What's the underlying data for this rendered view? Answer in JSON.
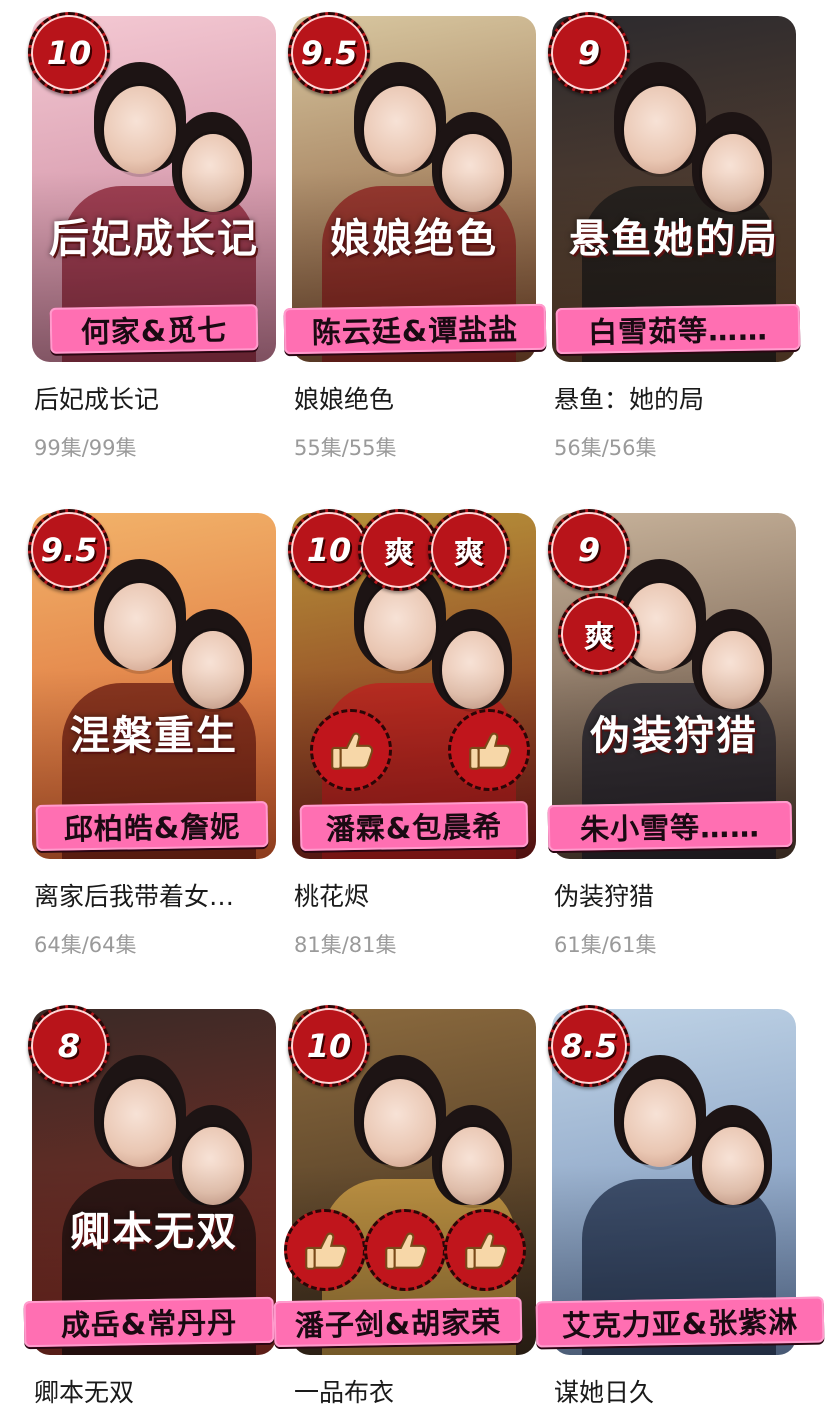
{
  "dramas": [
    {
      "title": "后妃成长记",
      "episodes": "99集/99集",
      "cast": "何家&觅七",
      "poster_title": "后妃成长记",
      "badges": [
        "10"
      ],
      "thumbs": 0,
      "bg": [
        "#f4c9d3",
        "#c27a93"
      ],
      "accent": "#8a1e32"
    },
    {
      "title": "娘娘绝色",
      "episodes": "55集/55集",
      "cast": "陈云廷&谭盐盐",
      "poster_title": "娘娘绝色",
      "badges": [
        "9.5"
      ],
      "thumbs": 0,
      "bg": [
        "#d8c7a0",
        "#7c4a2c"
      ],
      "accent": "#8e1c1c"
    },
    {
      "title": "悬鱼：她的局",
      "episodes": "56集/56集",
      "cast": "白雪茹等……",
      "poster_title": "悬鱼她的局",
      "badges": [
        "9"
      ],
      "thumbs": 0,
      "bg": [
        "#2c2a2e",
        "#6b4a30"
      ],
      "accent": "#191919"
    },
    {
      "title": "离家后我带着女…",
      "episodes": "64集/64集",
      "cast": "邱柏皓&詹妮",
      "poster_title": "涅槃重生",
      "badges": [
        "9.5"
      ],
      "thumbs": 0,
      "bg": [
        "#f2b36a",
        "#d65a2c"
      ],
      "accent": "#6a1a10"
    },
    {
      "title": "桃花烬",
      "episodes": "81集/81集",
      "cast": "潘霖&包晨希",
      "poster_title": "",
      "badges": [
        "10",
        "爽",
        "爽"
      ],
      "thumbs": 2,
      "bg": [
        "#b8943a",
        "#7a1818"
      ],
      "accent": "#c41f1f"
    },
    {
      "title": "伪装狩猎",
      "episodes": "61集/61集",
      "cast": "朱小雪等……",
      "poster_title": "伪装狩猎",
      "badges": [
        "9",
        "爽"
      ],
      "thumbs": 0,
      "bg": [
        "#c7b29a",
        "#4e3a2e"
      ],
      "accent": "#1d1d2a"
    },
    {
      "title": "卿本无双",
      "episodes": "",
      "cast": "成岳&常丹丹",
      "poster_title": "卿本无双",
      "badges": [
        "8"
      ],
      "thumbs": 0,
      "bg": [
        "#3a2a26",
        "#8e2e24"
      ],
      "accent": "#1a0f0f"
    },
    {
      "title": "一品布衣",
      "episodes": "",
      "cast": "潘子剑&胡家荣",
      "poster_title": "",
      "badges": [
        "10"
      ],
      "thumbs": 3,
      "bg": [
        "#8b6a3e",
        "#3a2a1c"
      ],
      "accent": "#d9a84a"
    },
    {
      "title": "谋她日久",
      "episodes": "",
      "cast": "艾克力亚&张紫淋",
      "poster_title": "",
      "badges": [
        "8.5"
      ],
      "thumbs": 0,
      "bg": [
        "#bfd3e6",
        "#6d88b2"
      ],
      "accent": "#1f2e4a"
    }
  ]
}
